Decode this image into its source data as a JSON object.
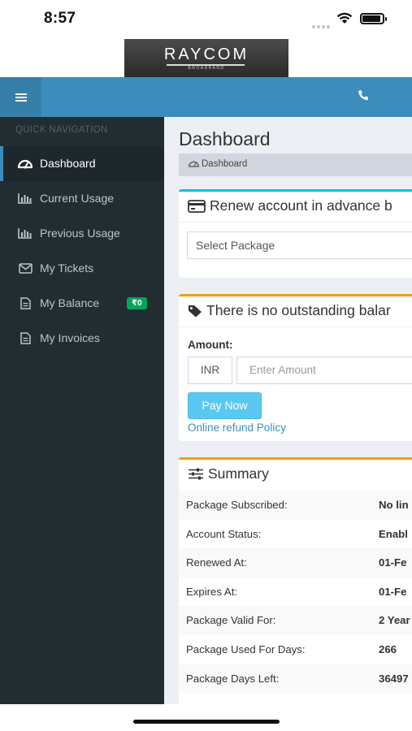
{
  "status_bar": {
    "time": "8:57",
    "signal_icon": "signal-dots-icon",
    "wifi_icon": "wifi-icon",
    "battery_icon": "battery-icon"
  },
  "logo": {
    "text": "RAYCOM",
    "subtext": "BROADBAND"
  },
  "header": {
    "menu_icon": "hamburger-menu-icon",
    "phone_icon": "phone-icon",
    "color": "#3c8dbc"
  },
  "sidebar": {
    "heading": "QUICK NAVIGATION",
    "items": [
      {
        "label": "Dashboard",
        "icon": "dashboard-icon",
        "active": true
      },
      {
        "label": "Current Usage",
        "icon": "bar-chart-icon"
      },
      {
        "label": "Previous Usage",
        "icon": "bar-chart-icon"
      },
      {
        "label": "My Tickets",
        "icon": "envelope-icon"
      },
      {
        "label": "My Balance",
        "icon": "file-icon",
        "badge": "₹0"
      },
      {
        "label": "My Invoices",
        "icon": "file-icon"
      }
    ]
  },
  "main": {
    "title": "Dashboard",
    "breadcrumb": "Dashboard",
    "renew_box": {
      "title": "Renew account in advance b",
      "select_value": "Select Package",
      "accent": "#00c0ef"
    },
    "balance_box": {
      "title": "There is no outstanding balar",
      "amount_label": "Amount:",
      "currency": "INR",
      "amount_placeholder": "Enter Amount",
      "pay_button": "Pay Now",
      "refund_link": "Online refund Policy",
      "accent": "#f39c12"
    },
    "summary_box": {
      "title": "Summary",
      "rows": [
        {
          "label": "Package Subscribed:",
          "value": "No lin"
        },
        {
          "label": "Account Status:",
          "value": "Enabl"
        },
        {
          "label": "Renewed At:",
          "value": "01-Fe"
        },
        {
          "label": "Expires At:",
          "value": "01-Fe"
        },
        {
          "label": "Package Valid For:",
          "value": "2 Year"
        },
        {
          "label": "Package Used For Days:",
          "value": "266"
        },
        {
          "label": "Package Days Left:",
          "value": "36497"
        }
      ]
    }
  }
}
